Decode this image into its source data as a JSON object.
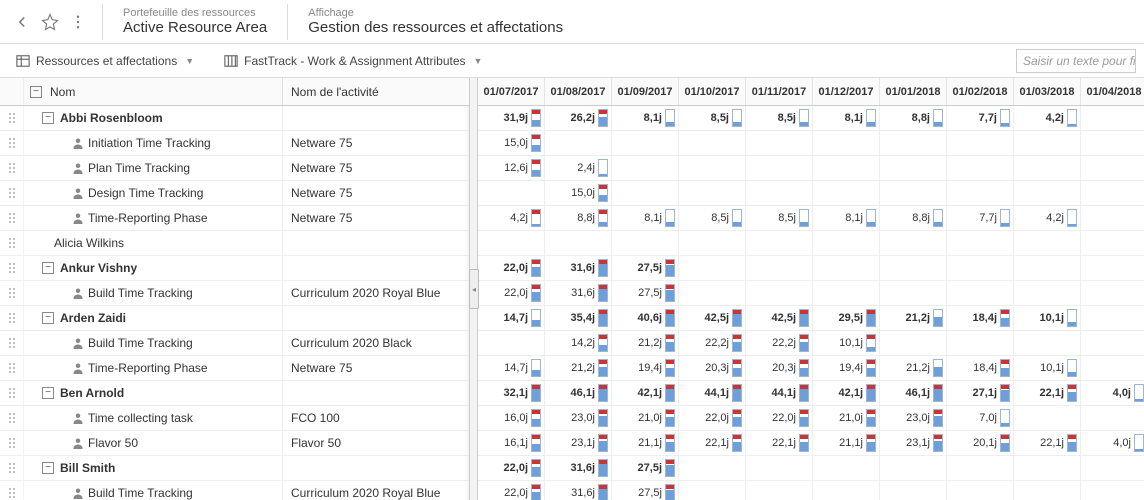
{
  "header": {
    "portfolio_label": "Portefeuille des ressources",
    "portfolio_value": "Active Resource Area",
    "view_label": "Affichage",
    "view_value": "Gestion des ressources et affectations"
  },
  "toolbar": {
    "tab1": "Ressources et affectations",
    "tab2": "FastTrack - Work & Assignment Attributes",
    "search_placeholder": "Saisir un texte pour filtr"
  },
  "columns": {
    "name": "Nom",
    "activity": "Nom de l'activité",
    "dates": [
      "01/07/2017",
      "01/08/2017",
      "01/09/2017",
      "01/10/2017",
      "01/11/2017",
      "01/12/2017",
      "01/01/2018",
      "01/02/2018",
      "01/03/2018",
      "01/04/2018"
    ]
  },
  "rows": [
    {
      "type": "summary",
      "name": "Abbi Rosenbloom",
      "vals": [
        {
          "v": "31,9j",
          "f": 40,
          "o": 1
        },
        {
          "v": "26,2j",
          "f": 55,
          "o": 1
        },
        {
          "v": "8,1j",
          "f": 25,
          "o": 0
        },
        {
          "v": "8,5j",
          "f": 25,
          "o": 0
        },
        {
          "v": "8,5j",
          "f": 25,
          "o": 0
        },
        {
          "v": "8,1j",
          "f": 25,
          "o": 0
        },
        {
          "v": "8,8j",
          "f": 25,
          "o": 0
        },
        {
          "v": "7,7j",
          "f": 20,
          "o": 0
        },
        {
          "v": "4,2j",
          "f": 12,
          "o": 0
        },
        null
      ]
    },
    {
      "type": "child",
      "name": "Initiation Time Tracking",
      "activity": "Netware 75",
      "vals": [
        {
          "v": "15,0j",
          "f": 40,
          "o": 1
        },
        null,
        null,
        null,
        null,
        null,
        null,
        null,
        null,
        null
      ]
    },
    {
      "type": "child",
      "name": "Plan Time Tracking",
      "activity": "Netware 75",
      "vals": [
        {
          "v": "12,6j",
          "f": 35,
          "o": 1
        },
        {
          "v": "2,4j",
          "f": 10,
          "o": 0
        },
        null,
        null,
        null,
        null,
        null,
        null,
        null,
        null
      ]
    },
    {
      "type": "child",
      "name": "Design Time Tracking",
      "activity": "Netware 75",
      "vals": [
        null,
        {
          "v": "15,0j",
          "f": 40,
          "o": 1
        },
        null,
        null,
        null,
        null,
        null,
        null,
        null,
        null
      ]
    },
    {
      "type": "child",
      "name": "Time-Reporting Phase",
      "activity": "Netware 75",
      "vals": [
        {
          "v": "4,2j",
          "f": 12,
          "o": 1
        },
        {
          "v": "8,8j",
          "f": 25,
          "o": 1
        },
        {
          "v": "8,1j",
          "f": 25,
          "o": 0
        },
        {
          "v": "8,5j",
          "f": 25,
          "o": 0
        },
        {
          "v": "8,5j",
          "f": 25,
          "o": 0
        },
        {
          "v": "8,1j",
          "f": 25,
          "o": 0
        },
        {
          "v": "8,8j",
          "f": 25,
          "o": 0
        },
        {
          "v": "7,7j",
          "f": 20,
          "o": 0
        },
        {
          "v": "4,2j",
          "f": 12,
          "o": 0
        },
        null
      ]
    },
    {
      "type": "plain",
      "name": "Alicia Wilkins",
      "vals": [
        null,
        null,
        null,
        null,
        null,
        null,
        null,
        null,
        null,
        null
      ]
    },
    {
      "type": "summary",
      "name": "Ankur Vishny",
      "vals": [
        {
          "v": "22,0j",
          "f": 55,
          "o": 1
        },
        {
          "v": "31,6j",
          "f": 80,
          "o": 1
        },
        {
          "v": "27,5j",
          "f": 70,
          "o": 1
        },
        null,
        null,
        null,
        null,
        null,
        null,
        null
      ]
    },
    {
      "type": "child",
      "name": "Build Time Tracking",
      "activity": "Curriculum 2020 Royal Blue",
      "vals": [
        {
          "v": "22,0j",
          "f": 55,
          "o": 1
        },
        {
          "v": "31,6j",
          "f": 80,
          "o": 1
        },
        {
          "v": "27,5j",
          "f": 70,
          "o": 1
        },
        null,
        null,
        null,
        null,
        null,
        null,
        null
      ]
    },
    {
      "type": "summary",
      "name": "Arden Zaidi",
      "vals": [
        {
          "v": "14,7j",
          "f": 40,
          "o": 0
        },
        {
          "v": "35,4j",
          "f": 90,
          "o": 1
        },
        {
          "v": "40,6j",
          "f": 100,
          "o": 1
        },
        {
          "v": "42,5j",
          "f": 100,
          "o": 1
        },
        {
          "v": "42,5j",
          "f": 100,
          "o": 1
        },
        {
          "v": "29,5j",
          "f": 75,
          "o": 1
        },
        {
          "v": "21,2j",
          "f": 55,
          "o": 0
        },
        {
          "v": "18,4j",
          "f": 48,
          "o": 1
        },
        {
          "v": "10,1j",
          "f": 28,
          "o": 0
        },
        null
      ]
    },
    {
      "type": "child",
      "name": "Build Time Tracking",
      "activity": "Curriculum 2020 Black",
      "vals": [
        null,
        {
          "v": "14,2j",
          "f": 38,
          "o": 1
        },
        {
          "v": "21,2j",
          "f": 55,
          "o": 1
        },
        {
          "v": "22,2j",
          "f": 58,
          "o": 1
        },
        {
          "v": "22,2j",
          "f": 58,
          "o": 1
        },
        {
          "v": "10,1j",
          "f": 28,
          "o": 1
        },
        null,
        null,
        null,
        null
      ]
    },
    {
      "type": "child",
      "name": "Time-Reporting Phase",
      "activity": "Netware 75",
      "vals": [
        {
          "v": "14,7j",
          "f": 40,
          "o": 0
        },
        {
          "v": "21,2j",
          "f": 55,
          "o": 1
        },
        {
          "v": "19,4j",
          "f": 50,
          "o": 1
        },
        {
          "v": "20,3j",
          "f": 52,
          "o": 1
        },
        {
          "v": "20,3j",
          "f": 52,
          "o": 1
        },
        {
          "v": "19,4j",
          "f": 50,
          "o": 1
        },
        {
          "v": "21,2j",
          "f": 55,
          "o": 0
        },
        {
          "v": "18,4j",
          "f": 48,
          "o": 1
        },
        {
          "v": "10,1j",
          "f": 28,
          "o": 0
        },
        null
      ]
    },
    {
      "type": "summary",
      "name": "Ben Arnold",
      "vals": [
        {
          "v": "32,1j",
          "f": 82,
          "o": 1
        },
        {
          "v": "46,1j",
          "f": 100,
          "o": 1
        },
        {
          "v": "42,1j",
          "f": 100,
          "o": 1
        },
        {
          "v": "44,1j",
          "f": 100,
          "o": 1
        },
        {
          "v": "44,1j",
          "f": 100,
          "o": 1
        },
        {
          "v": "42,1j",
          "f": 100,
          "o": 1
        },
        {
          "v": "46,1j",
          "f": 100,
          "o": 1
        },
        {
          "v": "27,1j",
          "f": 70,
          "o": 1
        },
        {
          "v": "22,1j",
          "f": 58,
          "o": 1
        },
        {
          "v": "4,0j",
          "f": 12,
          "o": 0
        }
      ]
    },
    {
      "type": "child",
      "name": "Time collecting task",
      "activity": "FCO 100",
      "vals": [
        {
          "v": "16,0j",
          "f": 42,
          "o": 1
        },
        {
          "v": "23,0j",
          "f": 60,
          "o": 1
        },
        {
          "v": "21,0j",
          "f": 55,
          "o": 1
        },
        {
          "v": "22,0j",
          "f": 58,
          "o": 1
        },
        {
          "v": "22,0j",
          "f": 58,
          "o": 1
        },
        {
          "v": "21,0j",
          "f": 55,
          "o": 1
        },
        {
          "v": "23,0j",
          "f": 60,
          "o": 1
        },
        {
          "v": "7,0j",
          "f": 20,
          "o": 0
        },
        null,
        null
      ]
    },
    {
      "type": "child",
      "name": "Flavor 50",
      "activity": "Flavor 50",
      "vals": [
        {
          "v": "16,1j",
          "f": 42,
          "o": 1
        },
        {
          "v": "23,1j",
          "f": 60,
          "o": 1
        },
        {
          "v": "21,1j",
          "f": 55,
          "o": 1
        },
        {
          "v": "22,1j",
          "f": 58,
          "o": 1
        },
        {
          "v": "22,1j",
          "f": 58,
          "o": 1
        },
        {
          "v": "21,1j",
          "f": 55,
          "o": 1
        },
        {
          "v": "23,1j",
          "f": 60,
          "o": 1
        },
        {
          "v": "20,1j",
          "f": 52,
          "o": 1
        },
        {
          "v": "22,1j",
          "f": 58,
          "o": 1
        },
        {
          "v": "4,0j",
          "f": 12,
          "o": 0
        }
      ]
    },
    {
      "type": "summary",
      "name": "Bill Smith",
      "vals": [
        {
          "v": "22,0j",
          "f": 55,
          "o": 1
        },
        {
          "v": "31,6j",
          "f": 80,
          "o": 1
        },
        {
          "v": "27,5j",
          "f": 70,
          "o": 1
        },
        null,
        null,
        null,
        null,
        null,
        null,
        null
      ]
    },
    {
      "type": "child",
      "name": "Build Time Tracking",
      "activity": "Curriculum 2020 Royal Blue",
      "vals": [
        {
          "v": "22,0j",
          "f": 55,
          "o": 1
        },
        {
          "v": "31,6j",
          "f": 80,
          "o": 1
        },
        {
          "v": "27,5j",
          "f": 70,
          "o": 1
        },
        null,
        null,
        null,
        null,
        null,
        null,
        null
      ]
    }
  ]
}
